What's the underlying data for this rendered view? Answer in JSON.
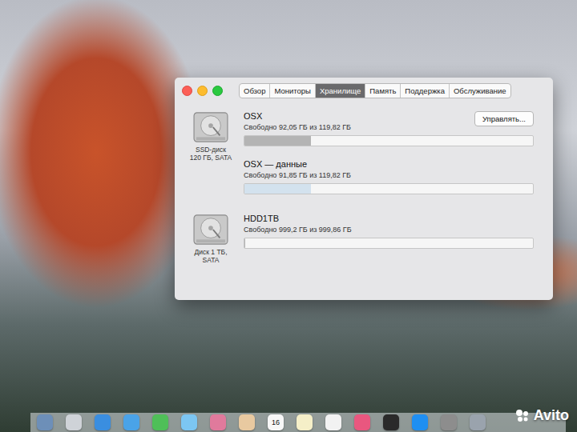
{
  "tabs": [
    {
      "label": "Обзор",
      "selected": false
    },
    {
      "label": "Мониторы",
      "selected": false
    },
    {
      "label": "Хранилище",
      "selected": true
    },
    {
      "label": "Память",
      "selected": false
    },
    {
      "label": "Поддержка",
      "selected": false
    },
    {
      "label": "Обслуживание",
      "selected": false
    }
  ],
  "drives": [
    {
      "label_lines": [
        "SSD-диск",
        "120 ГБ, SATA"
      ],
      "volumes": [
        {
          "name": "OSX",
          "free": "Свободно 92,05 ГБ из 119,82 ГБ",
          "level": 0.23,
          "color": "#b4b4b4",
          "button": "Управлять..."
        },
        {
          "name": "OSX — данные",
          "free": "Свободно 91,85 ГБ из 119,82 ГБ",
          "level": 0.23,
          "color": "#d3e2ee",
          "button": ""
        }
      ]
    },
    {
      "label_lines": [
        "Диск 1 ТБ,",
        "SATA"
      ],
      "volumes": [
        {
          "name": "HDD1TB",
          "free": "Свободно 999,2 ГБ из 999,86 ГБ",
          "level": 0.002,
          "color": "#b4b4b4",
          "button": ""
        }
      ]
    }
  ],
  "dock": {
    "items": [
      {
        "color": "#6d8fb8",
        "text": ""
      },
      {
        "color": "#cfd3d8",
        "text": ""
      },
      {
        "color": "#3a8ee0",
        "text": ""
      },
      {
        "color": "#4aa3e8",
        "text": ""
      },
      {
        "color": "#4fbf58",
        "text": ""
      },
      {
        "color": "#7cc6f2",
        "text": ""
      },
      {
        "color": "#e07a9c",
        "text": ""
      },
      {
        "color": "#e8c9a0",
        "text": ""
      },
      {
        "color": "#f7f7f7",
        "text": "16"
      },
      {
        "color": "#f5efc8",
        "text": ""
      },
      {
        "color": "#f2f2f2",
        "text": ""
      },
      {
        "color": "#e9577f",
        "text": ""
      },
      {
        "color": "#2a2a2a",
        "text": ""
      },
      {
        "color": "#1f8ff2",
        "text": ""
      },
      {
        "color": "#8d8d8d",
        "text": ""
      },
      {
        "color": "#9aa3ad",
        "text": ""
      }
    ]
  },
  "watermark": {
    "text": "Avito"
  }
}
